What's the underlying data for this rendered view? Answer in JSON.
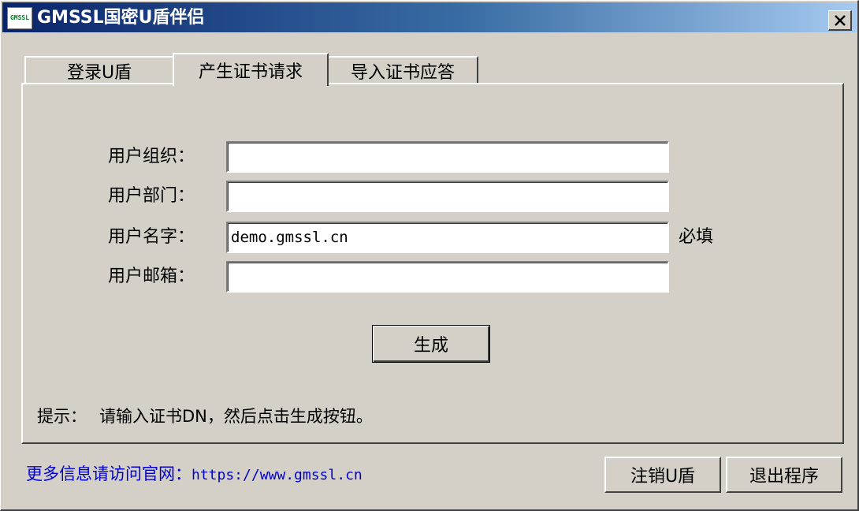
{
  "window": {
    "title": "GMSSL国密U盾伴侣",
    "logo_text": "GMSSL"
  },
  "tabs": [
    {
      "label": "登录U盾",
      "active": false
    },
    {
      "label": "产生证书请求",
      "active": true
    },
    {
      "label": "导入证书应答",
      "active": false
    }
  ],
  "form": {
    "org_label": "用户组织：",
    "org_value": "",
    "dept_label": "用户部门：",
    "dept_value": "",
    "name_label": "用户名字：",
    "name_value": "demo.gmssl.cn",
    "name_required": "必填",
    "email_label": "用户邮箱：",
    "email_value": ""
  },
  "generate_button": "生成",
  "hint": {
    "label": "提示：",
    "text": "请输入证书DN，然后点击生成按钮。"
  },
  "footer": {
    "info_text": "更多信息请访问官网：",
    "url": "https://www.gmssl.cn",
    "logout_button": "注销U盾",
    "exit_button": "退出程序"
  },
  "colors": {
    "title_gradient_start": "#0a246a",
    "title_gradient_end": "#a6caf0",
    "link": "#0000cc",
    "face": "#d4d0c8"
  }
}
